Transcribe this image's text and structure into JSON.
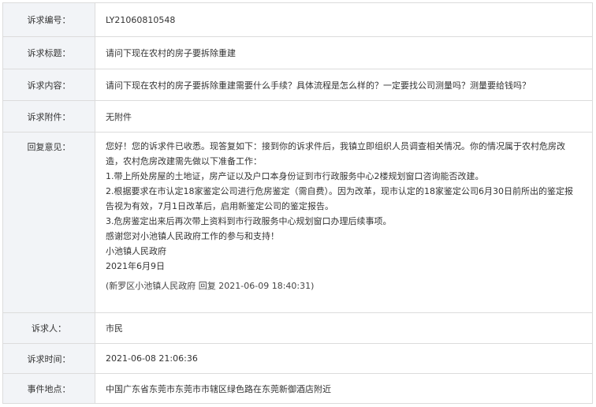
{
  "rows": {
    "number": {
      "label": "诉求编号：",
      "value": "LY21060810548"
    },
    "title": {
      "label": "诉求标题：",
      "value": "请问下现在农村的房子要拆除重建"
    },
    "content": {
      "label": "诉求内容：",
      "value": "请问下现在农村的房子要拆除重建需要什么手续？具体流程是怎么样的？一定要找公司测量吗？测量要给钱吗？"
    },
    "attachment": {
      "label": "诉求附件：",
      "value": "无附件"
    },
    "reply": {
      "label": "回复意见：",
      "lines": [
        "您好！您的诉求件已收悉。现答复如下：接到你的诉求件后，我镇立即组织人员调查相关情况。你的情况属于农村危房改",
        "造，农村危房改建需先做以下准备工作：",
        "1.带上所处房屋的土地证，房产证以及户口本身份证到市行政服务中心2楼规划窗口咨询能否改建。",
        "2.根据要求在市认定18家鉴定公司进行危房鉴定（需自费）。因为改革，现市认定的18家鉴定公司6月30日前所出的鉴定报",
        "告视为有效，7月1日改革后，启用新鉴定公司的鉴定报告。",
        "3.危房鉴定出来后再次带上资料到市行政服务中心规划窗口办理后续事项。",
        "感谢您对小池镇人民政府工作的参与和支持！",
        "小池镇人民政府",
        "2021年6月9日"
      ],
      "meta": "(新罗区小池镇人民政府 回复 2021-06-09 18:40:31)"
    },
    "petitioner": {
      "label": "诉求人：",
      "value": "市民"
    },
    "time": {
      "label": "诉求时间：",
      "value": "2021-06-08 21:06:36"
    },
    "location": {
      "label": "事件地点：",
      "value": "中国广东省东莞市东莞市市辖区绿色路在东莞新御酒店附近"
    }
  }
}
